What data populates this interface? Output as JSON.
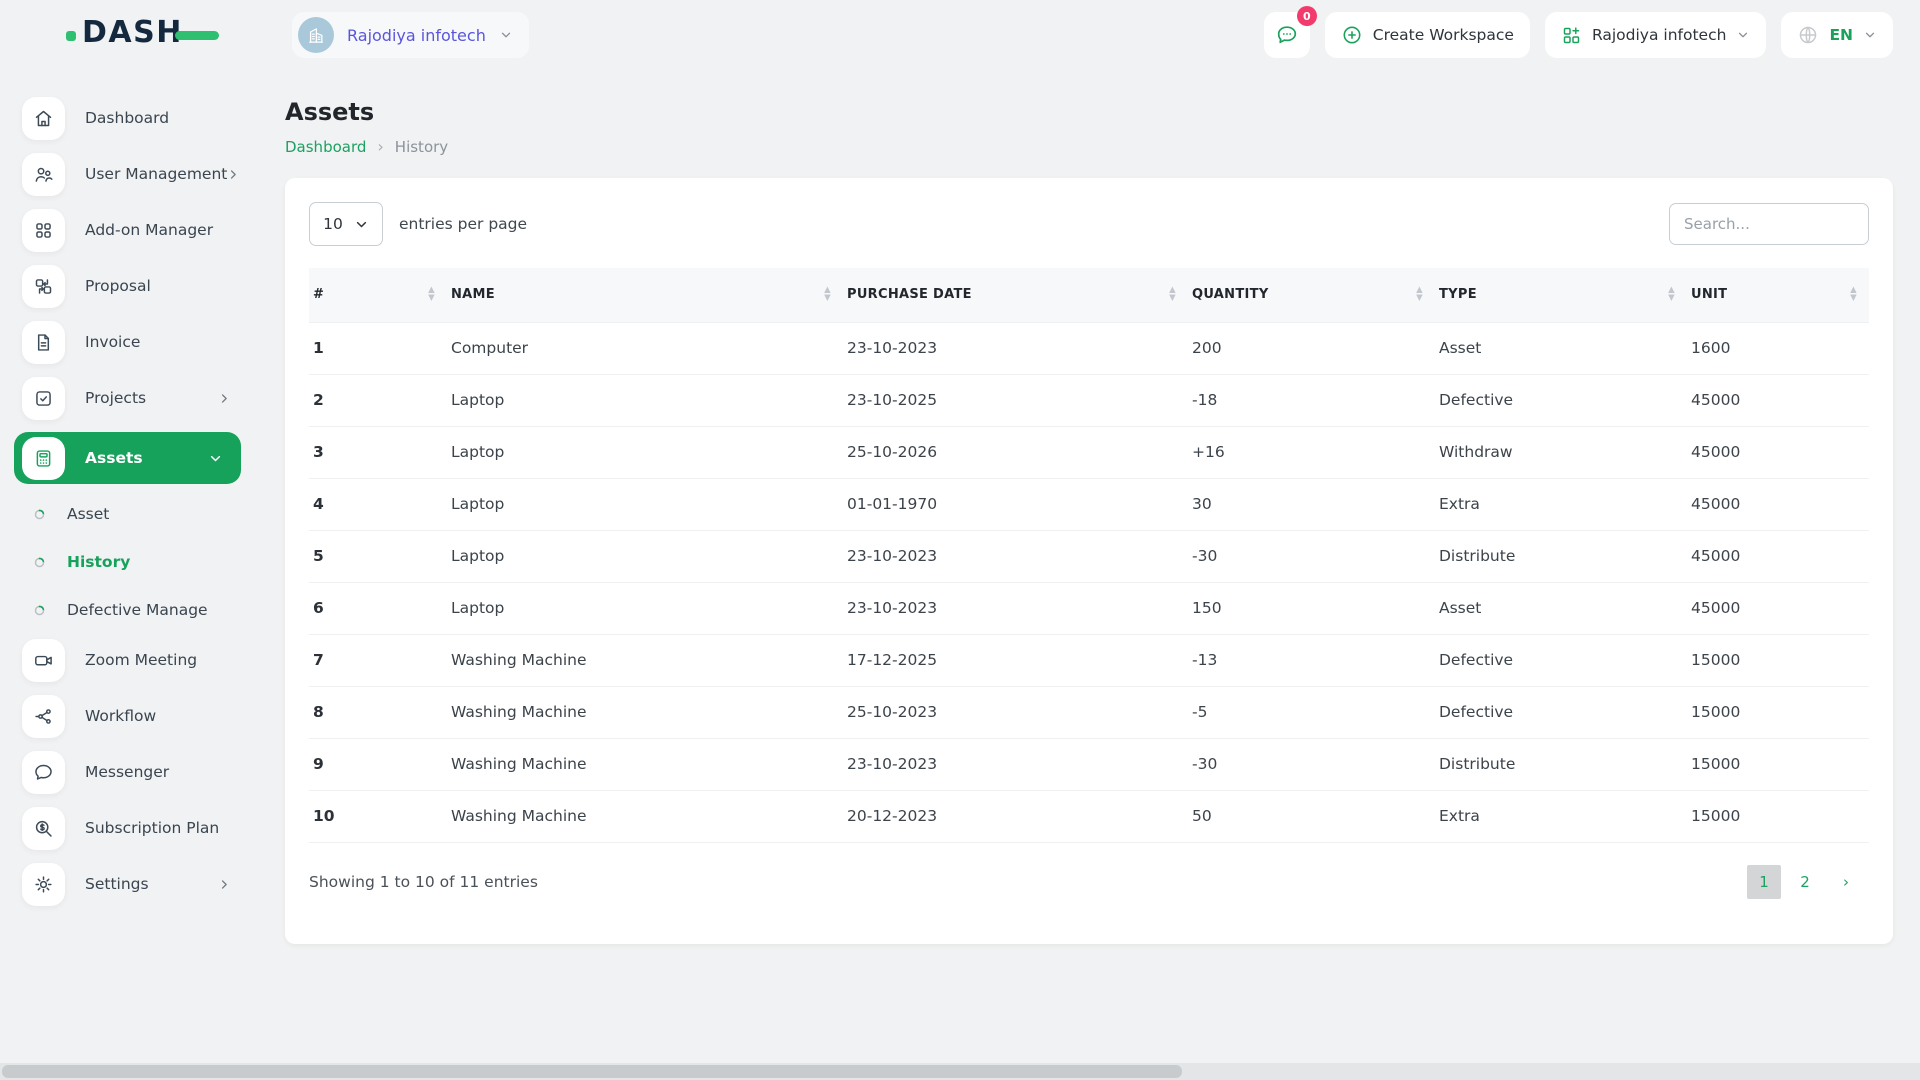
{
  "colors": {
    "primary_green": "#17a25c",
    "brand_navy": "#14293e",
    "brand_green": "#2fbf71",
    "workspace_purple": "#5a55dd",
    "badge_pink": "#f23a6c",
    "page_background": "#f1f2f3",
    "card_background": "#ffffff",
    "table_header_background": "#f7f8fa"
  },
  "brand": {
    "logo_text": "DASH"
  },
  "header": {
    "workspace": {
      "name": "Rajodiya infotech"
    },
    "messages": {
      "badge_count": "0"
    },
    "create_workspace": {
      "label": "Create Workspace"
    },
    "company": {
      "name": "Rajodiya infotech"
    },
    "language": {
      "code": "EN"
    }
  },
  "sidebar": {
    "items": [
      {
        "label": "Dashboard"
      },
      {
        "label": "User Management"
      },
      {
        "label": "Add-on Manager"
      },
      {
        "label": "Proposal"
      },
      {
        "label": "Invoice"
      },
      {
        "label": "Projects"
      },
      {
        "label": "Assets",
        "active": true
      },
      {
        "label": "Asset",
        "sub": true
      },
      {
        "label": "History",
        "sub": true,
        "active": true
      },
      {
        "label": "Defective Manage",
        "sub": true
      },
      {
        "label": "Zoom Meeting"
      },
      {
        "label": "Workflow"
      },
      {
        "label": "Messenger"
      },
      {
        "label": "Subscription Plan"
      },
      {
        "label": "Settings"
      }
    ]
  },
  "page": {
    "title": "Assets",
    "breadcrumb": {
      "parent": "Dashboard",
      "current": "History"
    }
  },
  "icons": {
    "sort_asc": "▲",
    "sort_desc": "▼",
    "breadcrumb_separator": "›"
  },
  "table": {
    "entries_per_page": {
      "value": "10",
      "label": "entries per page"
    },
    "search_placeholder": "Search...",
    "columns": [
      "#",
      "NAME",
      "PURCHASE DATE",
      "QUANTITY",
      "TYPE",
      "UNIT"
    ],
    "rows": [
      {
        "num": "1",
        "name": "Computer",
        "date": "23-10-2023",
        "qty": "200",
        "type": "Asset",
        "unit": "1600"
      },
      {
        "num": "2",
        "name": "Laptop",
        "date": "23-10-2025",
        "qty": "-18",
        "type": "Defective",
        "unit": "45000"
      },
      {
        "num": "3",
        "name": "Laptop",
        "date": "25-10-2026",
        "qty": "+16",
        "type": "Withdraw",
        "unit": "45000"
      },
      {
        "num": "4",
        "name": "Laptop",
        "date": "01-01-1970",
        "qty": "30",
        "type": "Extra",
        "unit": "45000"
      },
      {
        "num": "5",
        "name": "Laptop",
        "date": "23-10-2023",
        "qty": "-30",
        "type": "Distribute",
        "unit": "45000"
      },
      {
        "num": "6",
        "name": "Laptop",
        "date": "23-10-2023",
        "qty": "150",
        "type": "Asset",
        "unit": "45000"
      },
      {
        "num": "7",
        "name": "Washing Machine",
        "date": "17-12-2025",
        "qty": "-13",
        "type": "Defective",
        "unit": "15000"
      },
      {
        "num": "8",
        "name": "Washing Machine",
        "date": "25-10-2023",
        "qty": "-5",
        "type": "Defective",
        "unit": "15000"
      },
      {
        "num": "9",
        "name": "Washing Machine",
        "date": "23-10-2023",
        "qty": "-30",
        "type": "Distribute",
        "unit": "15000"
      },
      {
        "num": "10",
        "name": "Washing Machine",
        "date": "20-12-2023",
        "qty": "50",
        "type": "Extra",
        "unit": "15000"
      }
    ],
    "footer": {
      "showing": "Showing 1 to 10 of 11 entries"
    },
    "pagination": {
      "current_page": "1",
      "page_2": "2",
      "next": "›"
    }
  }
}
